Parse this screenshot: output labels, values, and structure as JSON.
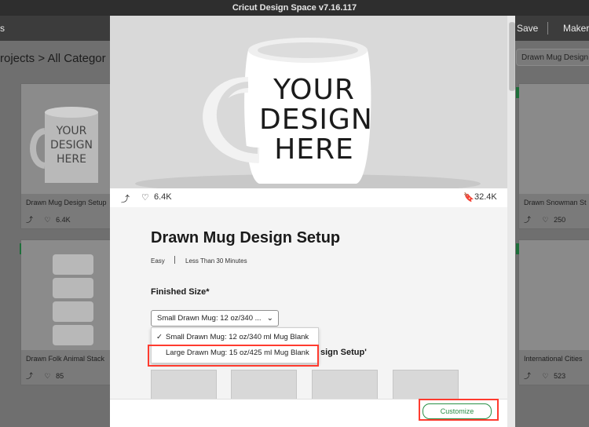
{
  "window": {
    "title": "Cricut Design Space  v7.16.117"
  },
  "appbar": {
    "left_fragment": "s",
    "save": "Save",
    "maker": "Maker"
  },
  "breadcrumb": {
    "text": "rojects > All Categor"
  },
  "search": {
    "value": "Drawn Mug Design"
  },
  "cards_left": [
    {
      "title": "Drawn Mug Design Setup",
      "likes": "6.4K",
      "image_text": "YOUR DESIGN HERE"
    },
    {
      "title": "Drawn Folk Animal Stack",
      "likes": "85"
    }
  ],
  "cards_right": [
    {
      "title": "Drawn Snowman St",
      "likes": "250"
    },
    {
      "title": "International Cities",
      "likes": "523"
    }
  ],
  "modal": {
    "hero_text": [
      "YOUR",
      "DESIGN",
      "HERE"
    ],
    "stats": {
      "likes": "6.4K",
      "bookmarks": "32.4K"
    },
    "title": "Drawn Mug Design Setup",
    "difficulty": "Easy",
    "time": "Less Than 30 Minutes",
    "finished_size_label": "Finished Size*",
    "select_value": "Small Drawn Mug: 12 oz/340 ...",
    "options": [
      {
        "label": "Small Drawn Mug: 12 oz/340 ml Mug Blank",
        "checked": true
      },
      {
        "label": "Large Drawn Mug: 15 oz/425 ml Mug Blank",
        "checked": false
      }
    ],
    "section_heading_fragment": "sign Setup'",
    "customize_label": "Customize"
  },
  "colors": {
    "brand_green": "#2a8f46",
    "highlight_red": "#ff3b2f"
  }
}
